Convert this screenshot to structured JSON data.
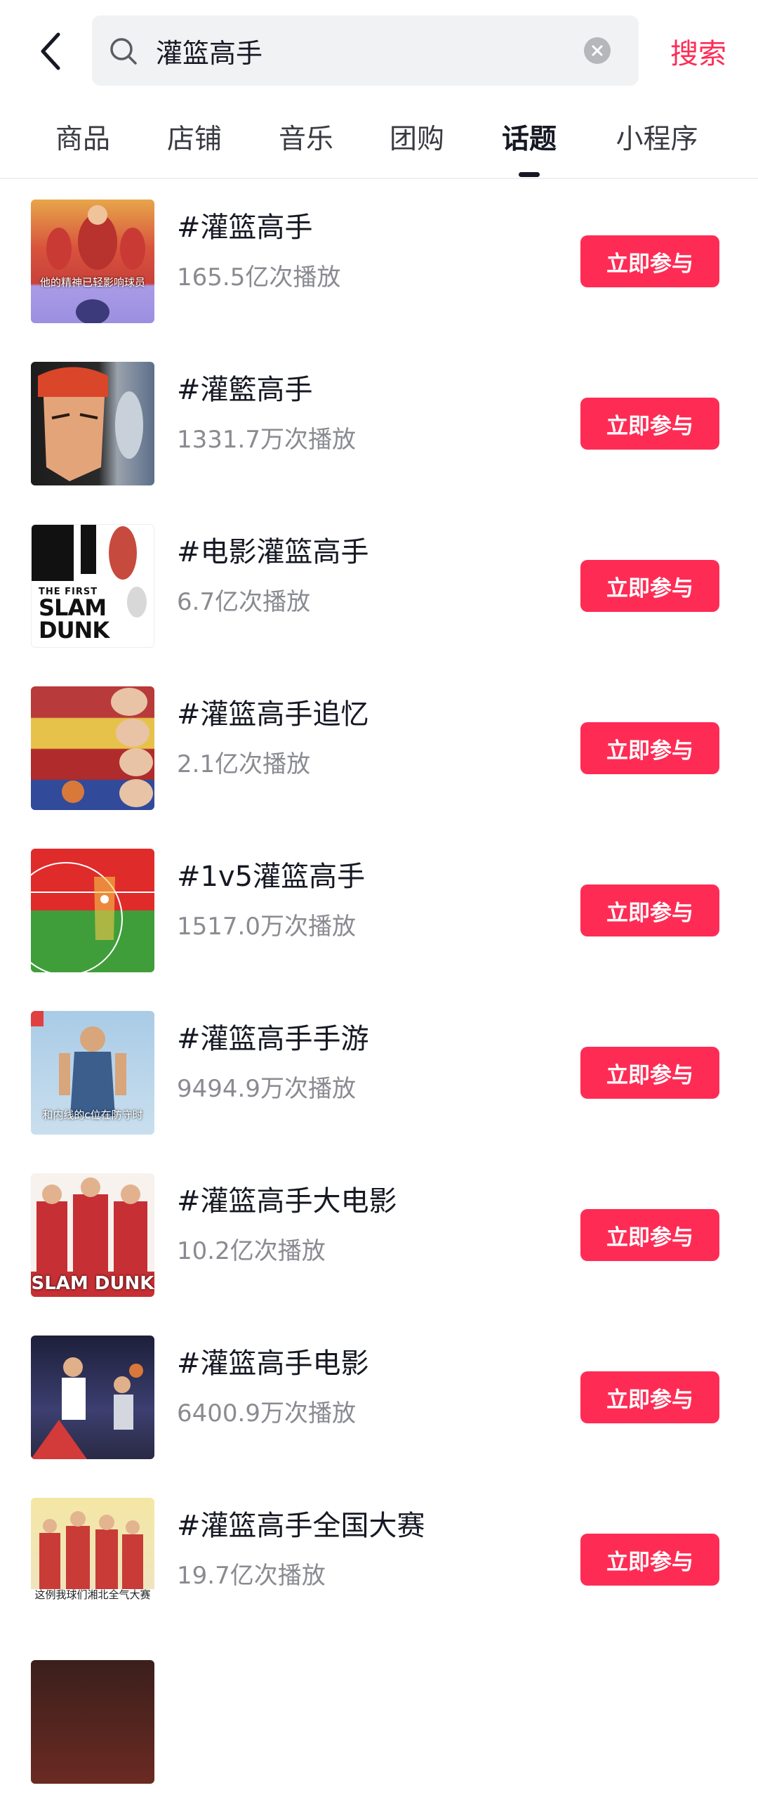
{
  "header": {
    "search_value": "灌篮高手",
    "search_button_label": "搜索",
    "back_icon": "chevron-left-icon",
    "search_icon": "search-icon",
    "clear_icon": "clear-icon"
  },
  "tabs": [
    {
      "label": "商品",
      "active": false
    },
    {
      "label": "店铺",
      "active": false
    },
    {
      "label": "音乐",
      "active": false
    },
    {
      "label": "团购",
      "active": false
    },
    {
      "label": "话题",
      "active": true
    },
    {
      "label": "小程序",
      "active": false
    }
  ],
  "topics": [
    {
      "title": "#灌篮高手",
      "plays": "165.5亿次播放",
      "button": "立即参与",
      "thumb_text": "他的精神已轻影响球员"
    },
    {
      "title": "#灌籃高手",
      "plays": "1331.7万次播放",
      "button": "立即参与"
    },
    {
      "title": "#电影灌篮高手",
      "plays": "6.7亿次播放",
      "button": "立即参与",
      "thumb_text_small": "THE FIRST",
      "thumb_text_big": "SLAM DUNK"
    },
    {
      "title": "#灌篮高手追忆",
      "plays": "2.1亿次播放",
      "button": "立即参与"
    },
    {
      "title": "#1v5灌篮高手",
      "plays": "1517.0万次播放",
      "button": "立即参与"
    },
    {
      "title": "#灌篮高手手游",
      "plays": "9494.9万次播放",
      "button": "立即参与",
      "thumb_text": "和内线的c位在防守时"
    },
    {
      "title": "#灌篮高手大电影",
      "plays": "10.2亿次播放",
      "button": "立即参与",
      "thumb_text": "SLAM DUNK"
    },
    {
      "title": "#灌篮高手电影",
      "plays": "6400.9万次播放",
      "button": "立即参与"
    },
    {
      "title": "#灌篮高手全国大赛",
      "plays": "19.7亿次播放",
      "button": "立即参与",
      "thumb_text": "这例我球们湘北全气大赛"
    }
  ],
  "colors": {
    "accent": "#fe2c55",
    "text_primary": "#161823",
    "text_secondary": "#8a8b91",
    "search_bg": "#f1f2f4"
  }
}
